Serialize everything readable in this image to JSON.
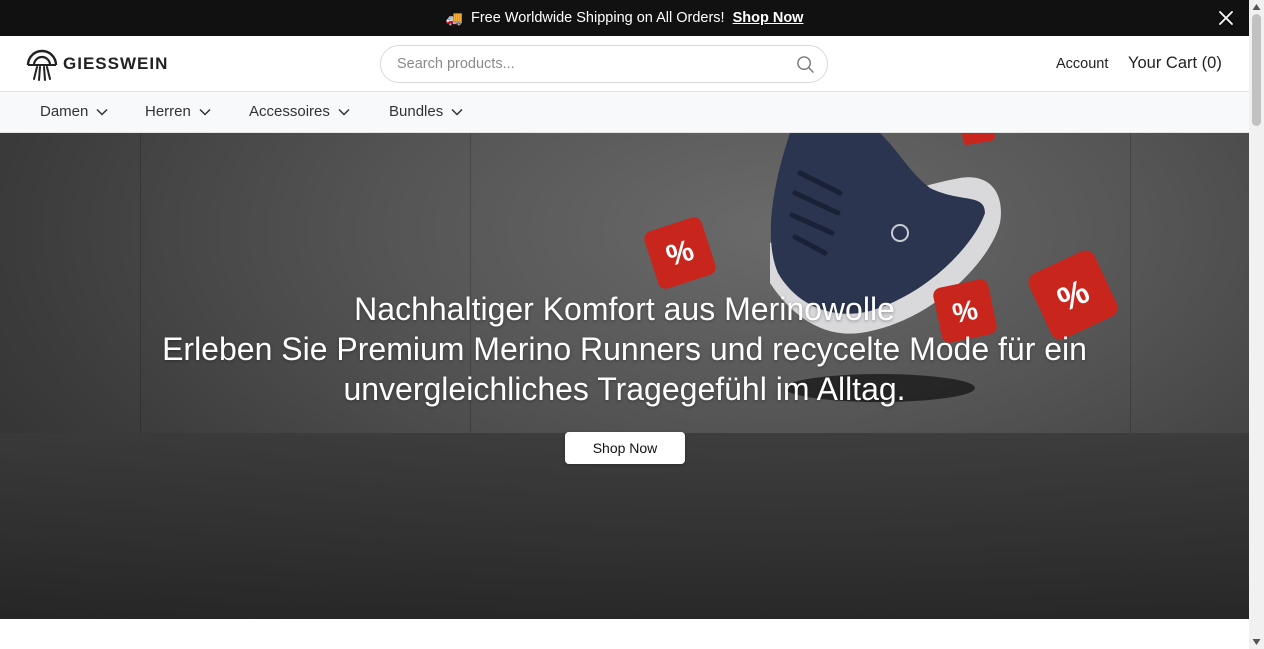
{
  "announcement": {
    "icon": "truck-icon",
    "text": "Free Worldwide Shipping on All Orders!",
    "link": "Shop Now"
  },
  "header": {
    "brand": "GIESSWEIN",
    "search": {
      "placeholder": "Search products...",
      "value": ""
    },
    "account_label": "Account",
    "cart_label": "Your Cart (0)"
  },
  "nav": {
    "items": [
      {
        "label": "Damen"
      },
      {
        "label": "Herren"
      },
      {
        "label": "Accessoires"
      },
      {
        "label": "Bundles"
      }
    ]
  },
  "hero": {
    "title": "Nachhaltiger Komfort aus Merinowolle",
    "subtitle": "Erleben Sie Premium Merino Runners und recycelte Mode für ein unvergleichliches Tragegefühl im Alltag.",
    "button": "Shop Now",
    "cube_symbol": "%"
  },
  "colors": {
    "announcement_bg": "#111111",
    "nav_bg": "#f8f9fb",
    "cube_red": "#c8261d",
    "shoe_navy": "#2b3550"
  }
}
